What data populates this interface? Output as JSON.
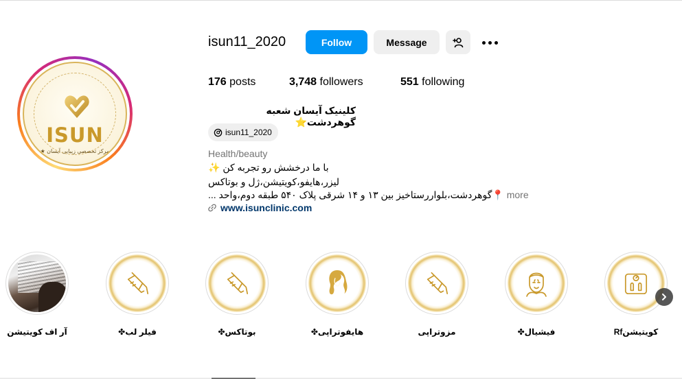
{
  "profile": {
    "username": "isun11_2020",
    "avatar": {
      "brand_text": "ISUN",
      "tagline": "مرکز تخصصی زیبایی آیسان ★",
      "icon": "heart-logo-icon"
    },
    "actions": {
      "follow_label": "Follow",
      "message_label": "Message",
      "suggest_icon": "add-person-icon",
      "more_icon": "more-horizontal-icon"
    },
    "stats": {
      "posts_count": "176",
      "posts_label": "posts",
      "followers_count": "3,748",
      "followers_label": "followers",
      "following_count": "551",
      "following_label": "following"
    },
    "full_name": "کلینیک آیسان شعبه گوهردشت⭐",
    "threads_handle": "isun11_2020",
    "category": "Health/beauty",
    "bio": {
      "line1": "با ما درخشش رو تجربه کن ✨",
      "line2": "لیزر،هایفو،کویتیشن،ژل و بوتاکس",
      "line3": "📍گوهردشت،بلواررستاخیز بین ۱۳ و ۱۴ شرقی پلاک ۵۴۰ طبقه دوم،واحد ...",
      "more_label": "more"
    },
    "website": "www.isunclinic.com"
  },
  "highlights": [
    {
      "label": "آر اف کویتیشن",
      "cover": "photo"
    },
    {
      "label": "فیلر لب✤",
      "cover": "syringe-icon"
    },
    {
      "label": "بوتاکس✤",
      "cover": "syringe-icon"
    },
    {
      "label": "هایفوتراپی✤",
      "cover": "hair-woman-icon"
    },
    {
      "label": "مزوتراپی",
      "cover": "syringe-icon"
    },
    {
      "label": "فیشیال✤",
      "cover": "face-mask-icon"
    },
    {
      "label": "کویتیشنRf",
      "cover": "body-scale-icon"
    }
  ],
  "colors": {
    "accent": "#0095f6",
    "gold": "#d6ad49",
    "link": "#00376b",
    "muted": "#737373"
  }
}
